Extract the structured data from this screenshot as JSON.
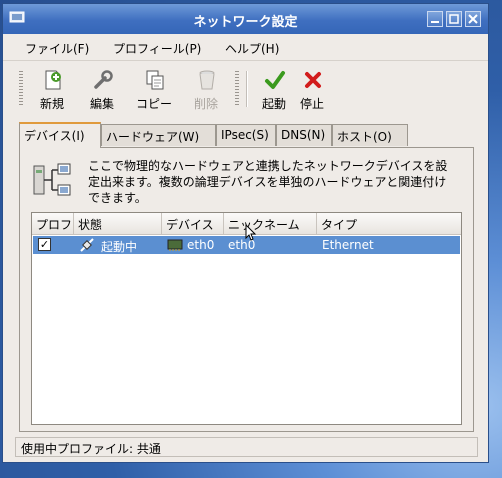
{
  "window": {
    "title": "ネットワーク設定"
  },
  "menubar": {
    "items": [
      "ファイル(F)",
      "プロフィール(P)",
      "ヘルプ(H)"
    ]
  },
  "toolbar": {
    "new_label": "新規",
    "edit_label": "編集",
    "copy_label": "コピー",
    "delete_label": "削除",
    "activate_label": "起動",
    "deactivate_label": "停止"
  },
  "tabs": [
    "デバイス(I)",
    "ハードウェア(W)",
    "IPsec(S)",
    "DNS(N)",
    "ホスト(O)"
  ],
  "description": "ここで物理的なハードウェアと連携したネットワークデバイスを設定出来ます。複数の論理デバイスを単独のハードウェアと関連付けできます。",
  "device_list": {
    "columns": [
      "プロフ",
      "状態",
      "デバイス",
      "ニックネーム",
      "タイプ"
    ],
    "rows": [
      {
        "profile_checked": true,
        "status": "起動中",
        "device": "eth0",
        "nickname": "eth0",
        "type": "Ethernet"
      }
    ]
  },
  "statusbar": {
    "text": "使用中プロファイル:  共通"
  },
  "colors": {
    "titlebar": "#3f6fc0",
    "selection": "#5b8fd1",
    "active_tab_accent": "#e09a3c",
    "window_bg": "#efebe7"
  }
}
